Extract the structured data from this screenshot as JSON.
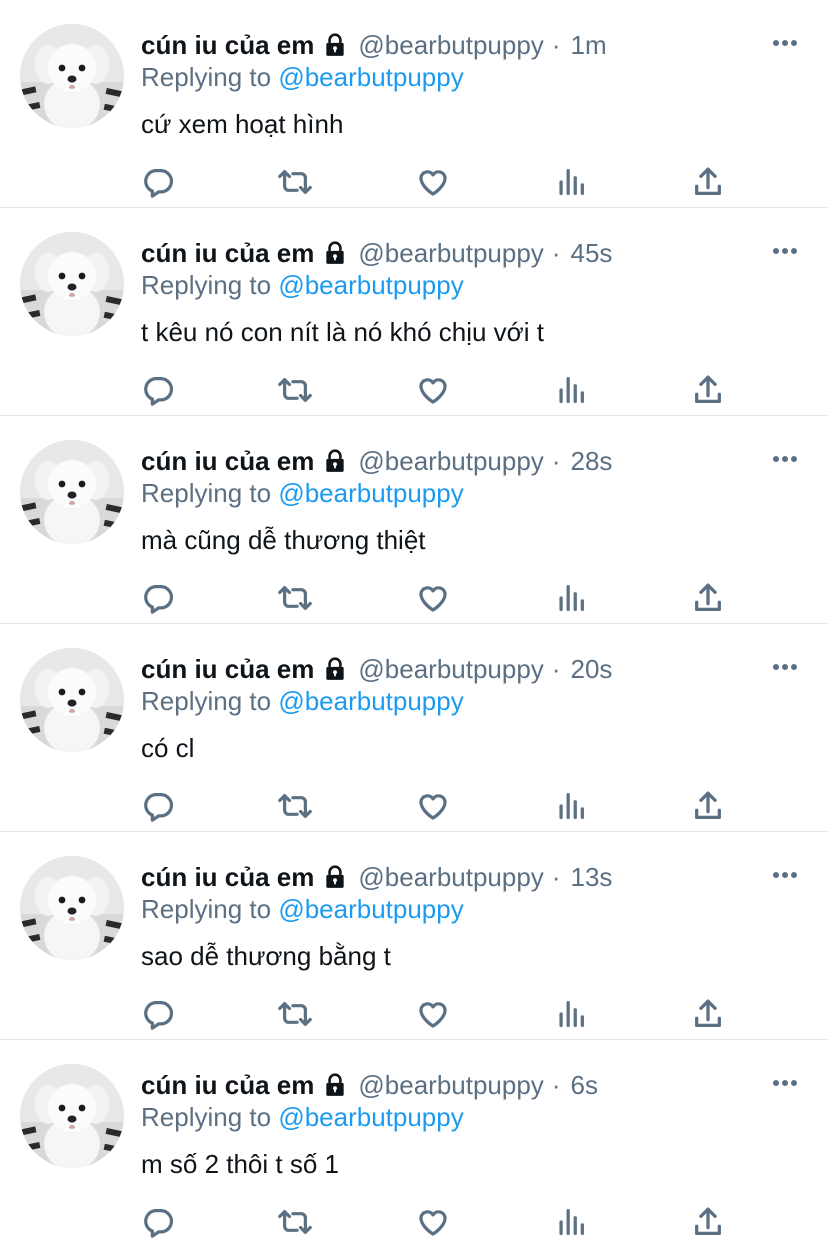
{
  "reply_prefix": "Replying to",
  "colors": {
    "text": "#0f1419",
    "muted": "#5b7083",
    "link": "#1d9bf0",
    "divider": "#e3e6e8"
  },
  "action_icons": [
    "reply-icon",
    "retweet-icon",
    "like-icon",
    "analytics-icon",
    "share-icon"
  ],
  "tweets": [
    {
      "name": "cún iu của em",
      "handle": "@bearbutpuppy",
      "separator": "·",
      "time": "1m",
      "replying_to": "@bearbutpuppy",
      "text": "cứ xem hoạt hình"
    },
    {
      "name": "cún iu của em",
      "handle": "@bearbutpuppy",
      "separator": "·",
      "time": "45s",
      "replying_to": "@bearbutpuppy",
      "text": "t kêu nó con nít là nó khó chịu với t"
    },
    {
      "name": "cún iu của em",
      "handle": "@bearbutpuppy",
      "separator": "·",
      "time": "28s",
      "replying_to": "@bearbutpuppy",
      "text": "mà cũng dễ thương thiệt"
    },
    {
      "name": "cún iu của em",
      "handle": "@bearbutpuppy",
      "separator": "·",
      "time": "20s",
      "replying_to": "@bearbutpuppy",
      "text": "có cl"
    },
    {
      "name": "cún iu của em",
      "handle": "@bearbutpuppy",
      "separator": "·",
      "time": "13s",
      "replying_to": "@bearbutpuppy",
      "text": "sao dễ thương bằng t"
    },
    {
      "name": "cún iu của em",
      "handle": "@bearbutpuppy",
      "separator": "·",
      "time": "6s",
      "replying_to": "@bearbutpuppy",
      "text": "m số 2 thôi t số 1"
    }
  ]
}
